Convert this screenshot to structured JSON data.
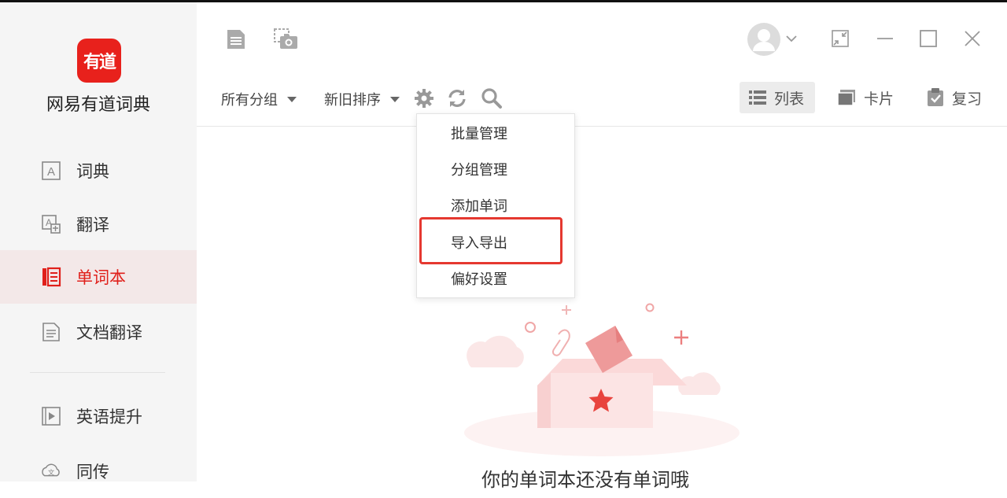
{
  "app": {
    "logo_text": "有道",
    "name": "网易有道词典",
    "accent": "#e8211c"
  },
  "sidebar": {
    "items": [
      {
        "label": "词典",
        "icon": "dictionary-icon",
        "active": false
      },
      {
        "label": "翻译",
        "icon": "translate-icon",
        "active": false
      },
      {
        "label": "单词本",
        "icon": "wordbook-icon",
        "active": true
      },
      {
        "label": "文档翻译",
        "icon": "document-translate-icon",
        "active": false
      },
      {
        "label": "英语提升",
        "icon": "video-play-icon",
        "active": false
      },
      {
        "label": "同传",
        "icon": "simultaneous-interpretation-icon",
        "active": false
      }
    ]
  },
  "toolbar": {
    "icons": [
      "document-icon",
      "screenshot-icon"
    ],
    "window_controls": [
      "avatar",
      "chevron-down-icon",
      "shrink-icon",
      "minimize-icon",
      "maximize-icon",
      "close-icon"
    ]
  },
  "filters": {
    "group": "所有分组",
    "sort": "新旧排序"
  },
  "views": {
    "list": "列表",
    "card": "卡片",
    "review": "复习",
    "active": "list"
  },
  "menu": {
    "items": [
      "批量管理",
      "分组管理",
      "添加单词",
      "导入导出",
      "偏好设置"
    ],
    "highlighted": "导入导出"
  },
  "empty_state": {
    "text": "你的单词本还没有单词哦"
  }
}
